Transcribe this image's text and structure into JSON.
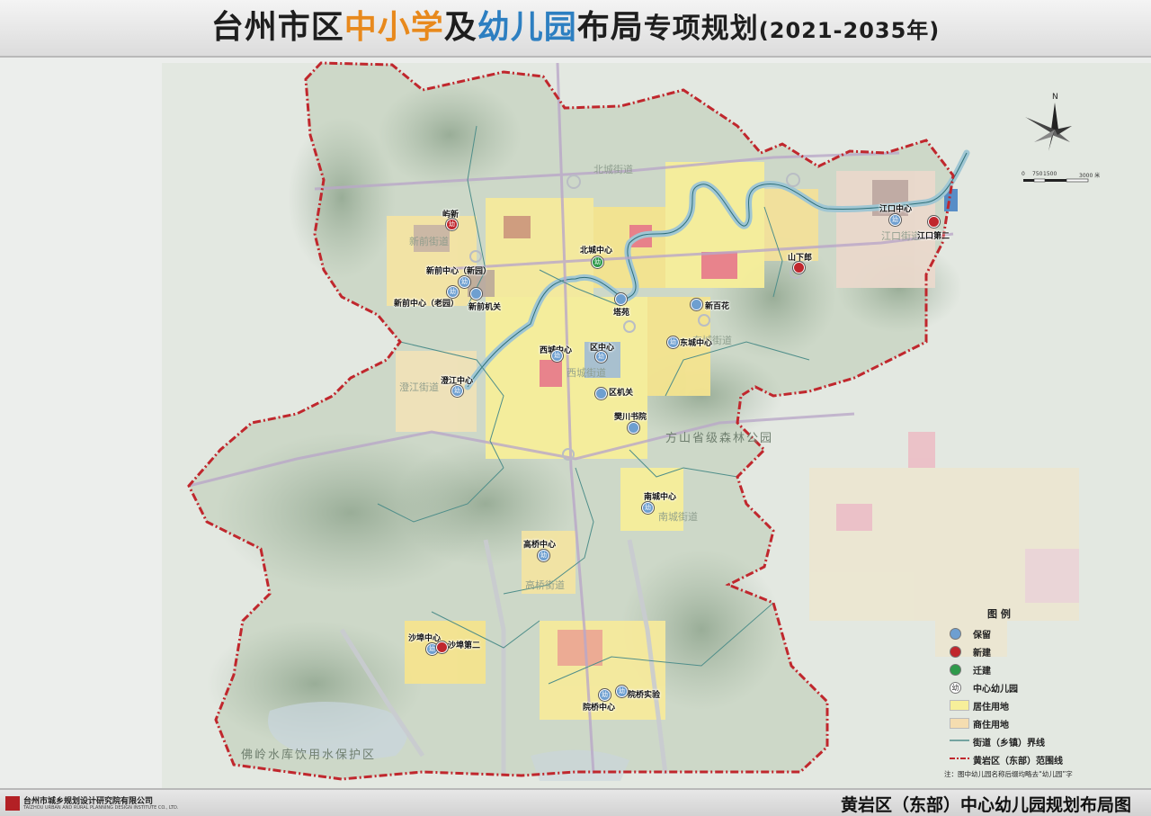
{
  "title": {
    "part1": "台州市区",
    "highlight1": "中小学",
    "join": "及",
    "highlight2": "幼儿园",
    "part2": "布局",
    "part3": "专项规划",
    "years": "(2021-2035年)"
  },
  "colors": {
    "orange": "#e8891c",
    "blue": "#2d7fc1",
    "boundary": "#c0272d",
    "keep": "#6e9fd0",
    "new": "#c0272d",
    "move": "#2e9a4a",
    "residential": "#f7ef9a",
    "commercial_residential": "#f5ddb0",
    "street_boundary": "#4f8e8a"
  },
  "map": {
    "road_labels": [
      "北城街道",
      "新前街道",
      "澄江街道",
      "西城街道",
      "东城街道",
      "南城街道",
      "高桥街道",
      "江口街道",
      "方山省级森林公园",
      "佛岭水库饮用水保护区"
    ],
    "kindergartens": [
      {
        "name": "屿新",
        "status": "new",
        "center": true
      },
      {
        "name": "北城中心",
        "status": "move",
        "center": true
      },
      {
        "name": "新前中心（新园）",
        "status": "keep",
        "center": true
      },
      {
        "name": "新前中心（老园）",
        "status": "keep",
        "center": true
      },
      {
        "name": "新前机关",
        "status": "keep",
        "center": false
      },
      {
        "name": "塔苑",
        "status": "keep",
        "center": false
      },
      {
        "name": "新百花",
        "status": "keep",
        "center": false
      },
      {
        "name": "江口中心",
        "status": "keep",
        "center": true
      },
      {
        "name": "江口第二",
        "status": "new",
        "center": false
      },
      {
        "name": "山下郎",
        "status": "new",
        "center": false
      },
      {
        "name": "西城中心",
        "status": "keep",
        "center": true
      },
      {
        "name": "区中心",
        "status": "keep",
        "center": true
      },
      {
        "name": "东城中心",
        "status": "keep",
        "center": true
      },
      {
        "name": "澄江中心",
        "status": "keep",
        "center": true
      },
      {
        "name": "区机关",
        "status": "keep",
        "center": false
      },
      {
        "name": "樊川书院",
        "status": "keep",
        "center": false
      },
      {
        "name": "南城中心",
        "status": "keep",
        "center": true
      },
      {
        "name": "高桥中心",
        "status": "keep",
        "center": true
      },
      {
        "name": "沙埠中心",
        "status": "keep",
        "center": true
      },
      {
        "name": "沙埠第二",
        "status": "new",
        "center": false
      },
      {
        "name": "院桥中心",
        "status": "keep",
        "center": true
      },
      {
        "name": "院桥实验",
        "status": "keep",
        "center": false
      }
    ],
    "center_glyph": "幼"
  },
  "compass": {
    "north": "N"
  },
  "scale": {
    "labels": [
      "0",
      "750",
      "1500",
      "3000 米"
    ]
  },
  "legend": {
    "title": "图 例",
    "items": [
      {
        "label": "保留",
        "kind": "dot-keep"
      },
      {
        "label": "新建",
        "kind": "dot-new"
      },
      {
        "label": "迁建",
        "kind": "dot-move"
      },
      {
        "label": "中心幼儿园",
        "kind": "glyph"
      },
      {
        "label": "居住用地",
        "kind": "swatch-res"
      },
      {
        "label": "商住用地",
        "kind": "swatch-com"
      },
      {
        "label": "街道（乡镇）界线",
        "kind": "line-street"
      },
      {
        "label": "黄岩区（东部）范围线",
        "kind": "line-boundary"
      }
    ],
    "note": "注：图中幼儿园名称后缀均略去“幼儿园”字"
  },
  "footer": {
    "org_name": "台州市城乡规划设计研究院有限公司",
    "org_en": "TAIZHOU URBAN AND RURAL PLANNING DESIGN INSTITUTE CO., LTD.",
    "map_title": "黄岩区（东部）中心幼儿园规划布局图"
  }
}
